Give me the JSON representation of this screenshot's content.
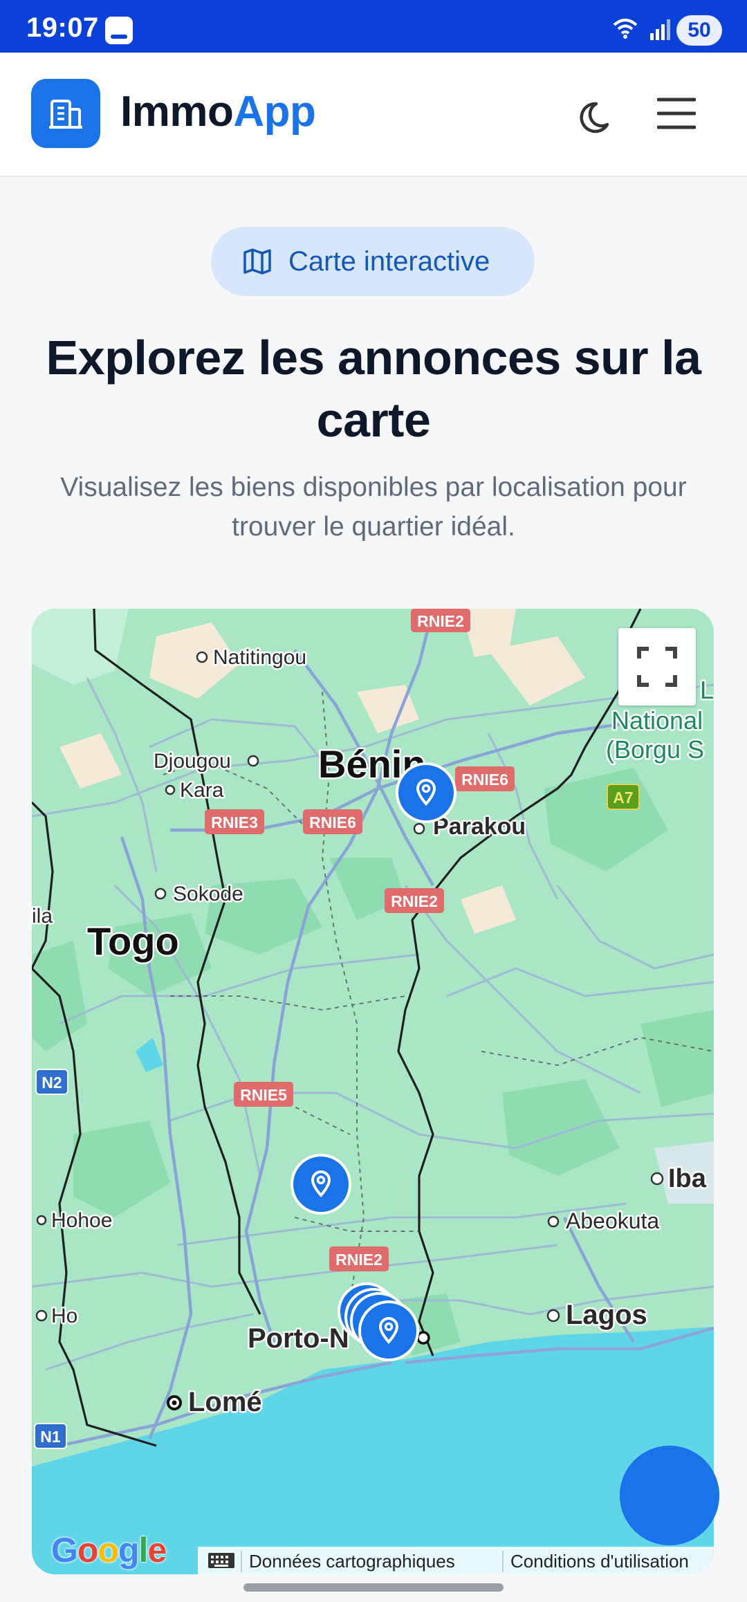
{
  "status_bar": {
    "time": "19:07",
    "battery": "50"
  },
  "header": {
    "brand_part1": "Immo",
    "brand_part2": "App"
  },
  "hero": {
    "badge": "Carte interactive",
    "title": "Explorez les annonces sur la carte",
    "subtitle": "Visualisez les biens disponibles par localisation pour trouver le quartier idéal."
  },
  "map": {
    "labels": {
      "natitingou": "Natitingou",
      "djougou": "Djougou",
      "kara": "Kara",
      "benin": "Bénin",
      "parakou": "Parakou",
      "sokode": "Sokode",
      "togo": "Togo",
      "hohoe": "Hohoe",
      "ho": "Ho",
      "porto_novo": "Porto-N",
      "lome": "Lomé",
      "lagos": "Lagos",
      "abeokuta": "Abeokuta",
      "iba": "Iba",
      "ila": "ila",
      "national": "National",
      "borgu": "(Borgu S",
      "park_l": "L"
    },
    "roads": {
      "rnie2_top": "RNIE2",
      "rnie6_a": "RNIE6",
      "rnie6_b": "RNIE6",
      "rnie3": "RNIE3",
      "rnie2_mid": "RNIE2",
      "rnie5": "RNIE5",
      "rnie2_bottom": "RNIE2",
      "a7": "A7",
      "n2": "N2",
      "n1": "N1"
    },
    "attribution": {
      "google": "Google",
      "data": "Données cartographiques",
      "terms": "Conditions d'utilisation"
    }
  },
  "colors": {
    "accent": "#1a73e8",
    "status_bar": "#0b41d9",
    "title": "#0f172a",
    "water": "#5fd6e8",
    "land": "#a9e6c6"
  }
}
